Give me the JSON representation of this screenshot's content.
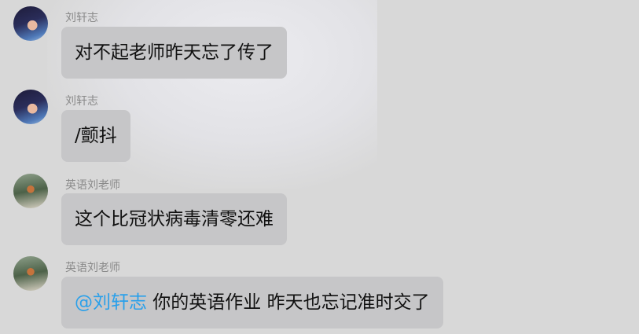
{
  "messages": [
    {
      "sender": "刘轩志",
      "avatar": "avatar-boy-anime",
      "text": "对不起老师昨天忘了传了"
    },
    {
      "sender": "刘轩志",
      "avatar": "avatar-boy-anime",
      "text": "/颤抖"
    },
    {
      "sender": "英语刘老师",
      "avatar": "avatar-soldier",
      "text": "这个比冠状病毒清零还难"
    },
    {
      "sender": "英语刘老师",
      "avatar": "avatar-soldier",
      "mention": "@刘轩志",
      "text": " 你的英语作业 昨天也忘记准时交了"
    }
  ],
  "colors": {
    "mention": "#2aa0ea",
    "bubble": "#c6c6c8",
    "background": "#d8d8d8"
  }
}
